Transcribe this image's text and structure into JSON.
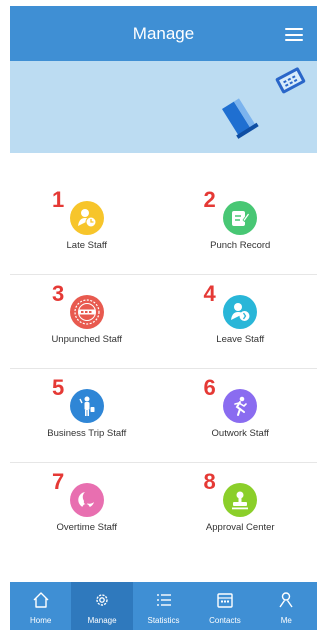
{
  "header": {
    "title": "Manage",
    "menu_icon": "hamburger-menu-icon"
  },
  "banner": {
    "illustration": "books-illustration"
  },
  "grid": {
    "items": [
      {
        "num": "1",
        "label": "Late Staff",
        "icon": "late-clock-icon",
        "color": "#f7c52b"
      },
      {
        "num": "2",
        "label": "Punch Record",
        "icon": "punch-record-icon",
        "color": "#48c774"
      },
      {
        "num": "3",
        "label": "Unpunched Staff",
        "icon": "unpunched-stamp-icon",
        "color": "#e85a4f"
      },
      {
        "num": "4",
        "label": "Leave Staff",
        "icon": "leave-person-icon",
        "color": "#29b6d8"
      },
      {
        "num": "5",
        "label": "Business Trip Staff",
        "icon": "business-trip-icon",
        "color": "#2f86d6"
      },
      {
        "num": "6",
        "label": "Outwork Staff",
        "icon": "outwork-running-icon",
        "color": "#8a6cf0"
      },
      {
        "num": "7",
        "label": "Overtime Staff",
        "icon": "overtime-moon-icon",
        "color": "#e86fb0"
      },
      {
        "num": "8",
        "label": "Approval Center",
        "icon": "approval-stamp-icon",
        "color": "#8bcf2a"
      }
    ]
  },
  "nav": {
    "active": "Manage",
    "tabs": [
      {
        "label": "Home",
        "icon": "home-icon"
      },
      {
        "label": "Manage",
        "icon": "gear-icon"
      },
      {
        "label": "Statistics",
        "icon": "list-icon"
      },
      {
        "label": "Contacts",
        "icon": "calendar-icon"
      },
      {
        "label": "Me",
        "icon": "person-icon"
      }
    ]
  }
}
